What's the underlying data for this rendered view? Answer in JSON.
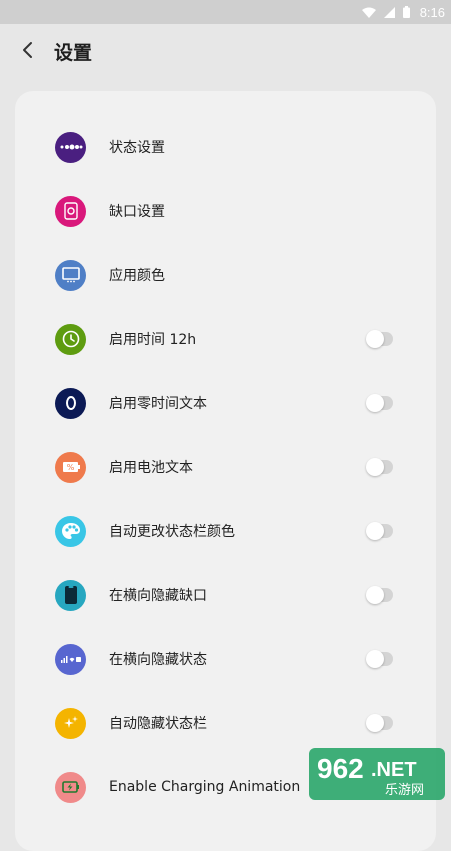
{
  "status_bar": {
    "time": "8:16"
  },
  "header": {
    "title": "设置"
  },
  "rows": [
    {
      "label": "状态设置",
      "icon": "status-dots-icon",
      "color": "#4a1f80",
      "toggle": false
    },
    {
      "label": "缺口设置",
      "icon": "notch-phone-icon",
      "color": "#d9187b",
      "toggle": false
    },
    {
      "label": "应用颜色",
      "icon": "monitor-icon",
      "color": "#4f7fc6",
      "toggle": false
    },
    {
      "label": "启用时间 12h",
      "icon": "clock-icon",
      "color": "#5e9c10",
      "toggle": true
    },
    {
      "label": "启用零时间文本",
      "icon": "zero-icon",
      "color": "#0c1a55",
      "toggle": true
    },
    {
      "label": "启用电池文本",
      "icon": "battery-percent-icon",
      "color": "#ef7a4c",
      "toggle": true
    },
    {
      "label": "自动更改状态栏颜色",
      "icon": "palette-icon",
      "color": "#39c6e6",
      "toggle": true
    },
    {
      "label": "在横向隐藏缺口",
      "icon": "phone-notch-icon",
      "color": "#27a7c0",
      "toggle": true
    },
    {
      "label": "在横向隐藏状态",
      "icon": "signal-status-icon",
      "color": "#5866d0",
      "toggle": true
    },
    {
      "label": "自动隐藏状态栏",
      "icon": "sparkle-icon",
      "color": "#f4b400",
      "toggle": true
    },
    {
      "label": "Enable Charging Animation",
      "icon": "charging-battery-icon",
      "color": "#f08a8a",
      "toggle": false
    }
  ],
  "watermark": {
    "brand": "962",
    "suffix": ".NET",
    "subtitle": "乐游网"
  }
}
